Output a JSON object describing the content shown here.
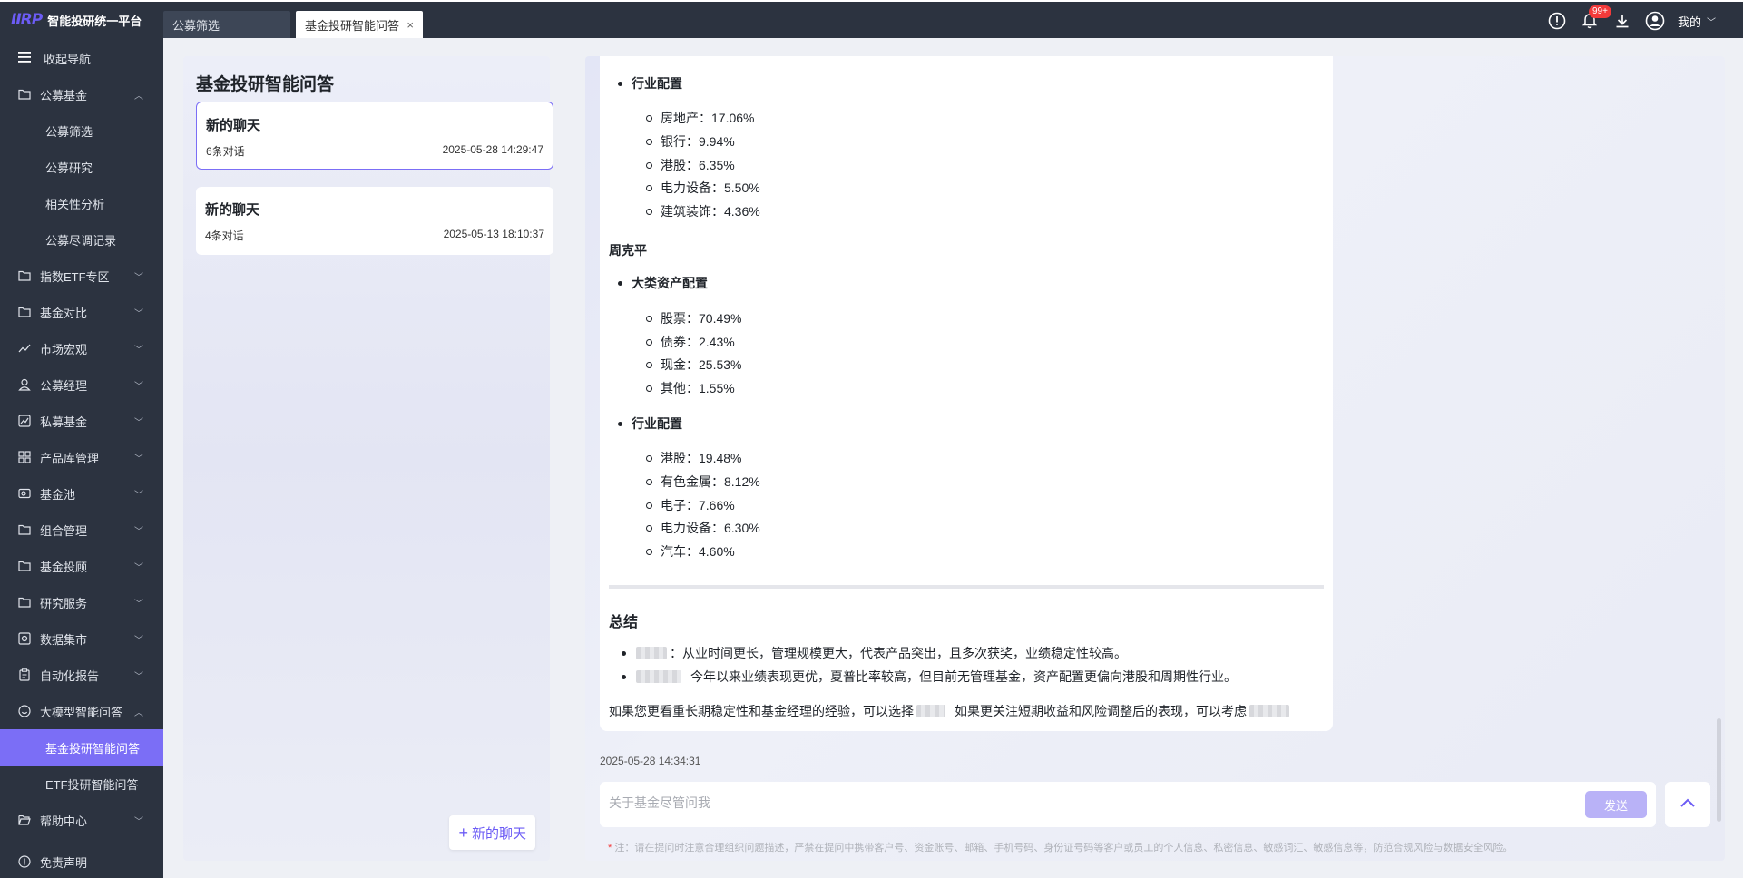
{
  "app": {
    "logo_mark": "IIRP",
    "logo_text": "智能投研统一平台"
  },
  "tabs": [
    {
      "label": "公募筛选"
    },
    {
      "label": "基金投研智能问答",
      "close": "×"
    }
  ],
  "topbar": {
    "badge": "99+",
    "user": "我的"
  },
  "sidebar": {
    "collapse": "收起导航",
    "groups": [
      {
        "label": "公募基金"
      },
      {
        "label": "指数ETF专区"
      },
      {
        "label": "基金对比"
      },
      {
        "label": "市场宏观"
      },
      {
        "label": "公募经理"
      },
      {
        "label": "私募基金"
      },
      {
        "label": "产品库管理"
      },
      {
        "label": "基金池"
      },
      {
        "label": "组合管理"
      },
      {
        "label": "基金投顾"
      },
      {
        "label": "研究服务"
      },
      {
        "label": "数据集市"
      },
      {
        "label": "自动化报告"
      },
      {
        "label": "大模型智能问答"
      },
      {
        "label": "帮助中心"
      },
      {
        "label": "免责声明"
      }
    ],
    "fund_subs": [
      "公募筛选",
      "公募研究",
      "相关性分析",
      "公募尽调记录"
    ],
    "ai_subs": [
      "基金投研智能问答",
      "ETF投研智能问答"
    ]
  },
  "history": {
    "title": "基金投研智能问答",
    "chats": [
      {
        "title": "新的聊天",
        "count": "6条对话",
        "time": "2025-05-28 14:29:47"
      },
      {
        "title": "新的聊天",
        "count": "4条对话",
        "time": "2025-05-13 18:10:37"
      }
    ],
    "new_chat": "新的聊天"
  },
  "answer": {
    "sec1_title": "行业配置",
    "sec1_items": [
      "房地产：17.06%",
      "银行：9.94%",
      "港股：6.35%",
      "电力设备：5.50%",
      "建筑装饰：4.36%"
    ],
    "manager": "周克平",
    "sec2_title": "大类资产配置",
    "sec2_items": [
      "股票：70.49%",
      "债券：2.43%",
      "现金：25.53%",
      "其他：1.55%"
    ],
    "sec3_title": "行业配置",
    "sec3_items": [
      "港股：19.48%",
      "有色金属：8.12%",
      "电子：7.66%",
      "电力设备：6.30%",
      "汽车：4.60%"
    ],
    "summary_title": "总结",
    "summary_1": "：从业时间更长，管理规模更大，代表产品突出，且多次获奖，业绩稳定性较高。",
    "summary_2": "今年以来业绩表现更优，夏普比率较高，但目前无管理基金，资产配置更偏向港股和周期性行业。",
    "closing_a": "如果您更看重长期稳定性和基金经理的经验，可以选择",
    "closing_b": "如果更关注短期收益和风险调整后的表现，可以考虑",
    "timestamp": "2025-05-28 14:34:31"
  },
  "input": {
    "placeholder": "关于基金尽管问我",
    "send": "发送",
    "note_star": "*",
    "note": "注：请在提问时注意合理组织问题描述，严禁在提问中携带客户号、资金账号、邮箱、手机号码、身份证号码等客户或员工的个人信息、私密信息、敏感词汇、敏感信息等，防范合规风险与数据安全风险。"
  }
}
